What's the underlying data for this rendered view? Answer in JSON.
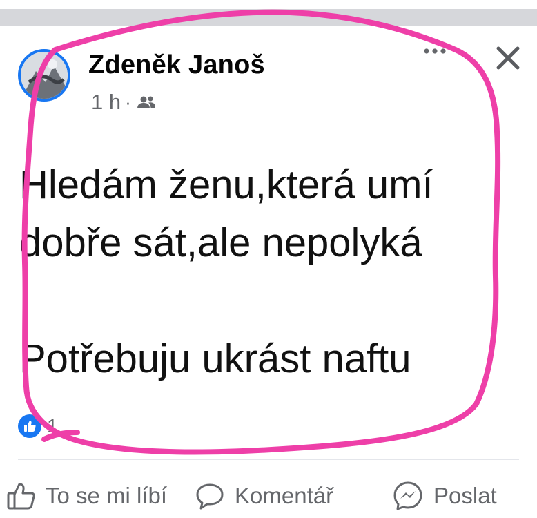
{
  "post": {
    "author": "Zdeněk Janoš",
    "time": "1 h",
    "separator": "·",
    "text_line1": "Hledám ženu,která umí",
    "text_line2": "dobře sát,ale nepolyká",
    "text_line3": "",
    "text_line4": "Potřebuju ukrást naftu",
    "reaction_count": "1"
  },
  "actions": {
    "like": "To se mi líbí",
    "comment": "Komentář",
    "share": "Poslat"
  },
  "icons": {
    "audience": "friends-icon",
    "more": "more-horizontal-icon",
    "close": "close-icon",
    "like": "thumbs-up-icon",
    "comment": "comment-bubble-icon",
    "share": "messenger-icon"
  },
  "colors": {
    "brand": "#1877f2",
    "secondary_text": "#65676b",
    "annotation": "#ee3fa8"
  }
}
